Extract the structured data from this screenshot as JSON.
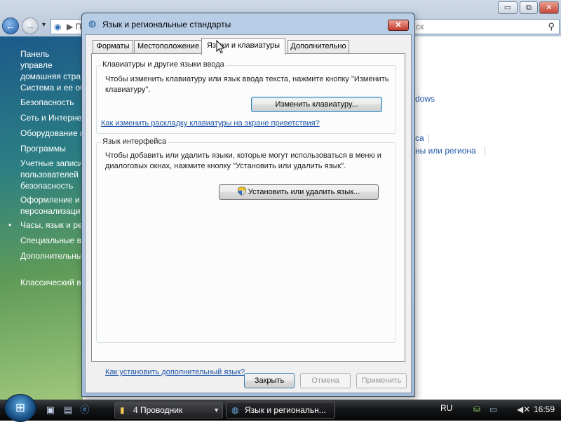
{
  "background_window": {
    "address_text": "▶ П",
    "search_placeholder": "ск",
    "min_label": "▭",
    "max_label": "⧉",
    "close_label": "✕",
    "sidebar": {
      "home": "Панель управле\nдомашняя стра",
      "items": [
        "Система и ее об",
        "Безопасность",
        "Сеть и Интерне",
        "Оборудование и",
        "Программы",
        "Учетные записи\nпользователей\nбезопасность",
        "Оформление и\nперсонализаци",
        "Часы, язык и ре",
        "Специальные в",
        "Дополнительны",
        "Классический в"
      ]
    },
    "main_links": [
      "dows",
      "са",
      "ны или региона"
    ]
  },
  "dialog": {
    "title": "Язык и региональные стандарты",
    "close_label": "✕",
    "tabs": [
      "Форматы",
      "Местоположение",
      "Языки и клавиатуры",
      "Дополнительно"
    ],
    "active_tab": "Языки и клавиатуры",
    "keyboard_group": {
      "title": "Клавиатуры и другие языки ввода",
      "description": "Чтобы изменить клавиатуру или язык ввода текста, нажмите кнопку \"Изменить клавиатуру\".",
      "button": "Изменить клавиатуру...",
      "link": "Как изменить раскладку клавиатуры на экране приветствия?"
    },
    "ui_language_group": {
      "title": "Язык интерфейса",
      "description": "Чтобы добавить или удалить языки, которые могут использоваться в меню и диалоговых окнах, нажмите кнопку \"Установить или удалить язык\".",
      "button": "Установить или удалить язык..."
    },
    "bottom_link": "Как установить дополнительный язык?",
    "buttons": {
      "close": "Закрыть",
      "cancel": "Отмена",
      "apply": "Применить"
    }
  },
  "taskbar": {
    "tasks": [
      {
        "label": "4 Проводник",
        "icon": "folder-icon"
      },
      {
        "label": "Язык и региональн...",
        "icon": "globe-icon"
      }
    ],
    "language": "RU",
    "clock": "16:59"
  }
}
